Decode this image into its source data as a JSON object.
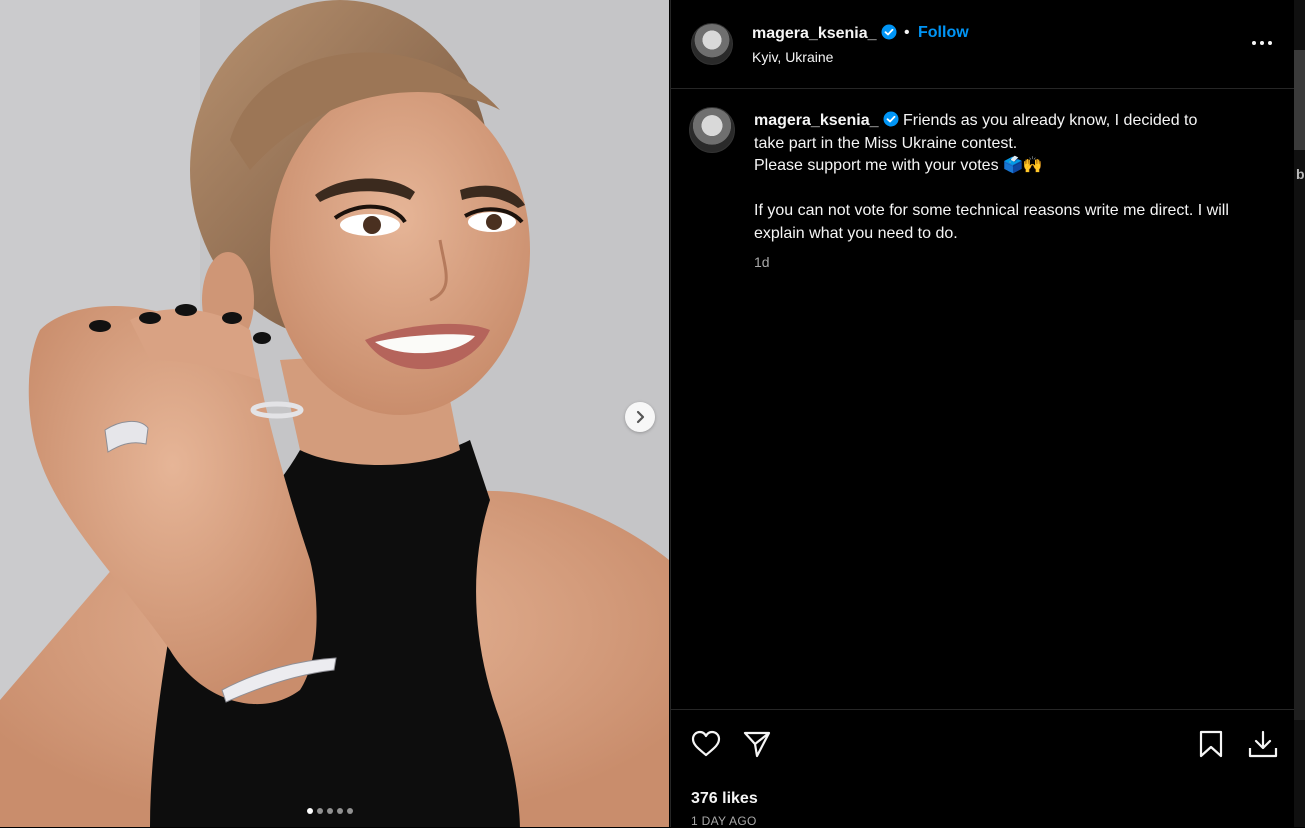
{
  "post": {
    "username": "magera_ksenia_",
    "separator": "•",
    "follow_label": "Follow",
    "location": "Kyiv, Ukraine",
    "caption_lines": [
      "Friends as you already know, I decided to",
      "take part in the Miss Ukraine contest.",
      "Please support me with your votes 🗳️🙌",
      "If you can not vote for some technical reasons write me direct. I will explain what you need to do."
    ],
    "caption_time": "1d",
    "likes": "376 likes",
    "posted_ago": "1 DAY AGO"
  },
  "carousel": {
    "slide_count": 5,
    "active_index": 0
  },
  "icons": {
    "verified": "verified-badge-icon",
    "more": "more-options-icon",
    "like": "heart-icon",
    "share": "share-icon",
    "save": "bookmark-icon",
    "download": "download-icon",
    "next": "chevron-right-icon"
  },
  "colors": {
    "background": "#000000",
    "link": "#0095f6",
    "verified": "#0095f6",
    "muted": "#a8a8a8"
  },
  "edge": {
    "partial_letter": "b"
  }
}
